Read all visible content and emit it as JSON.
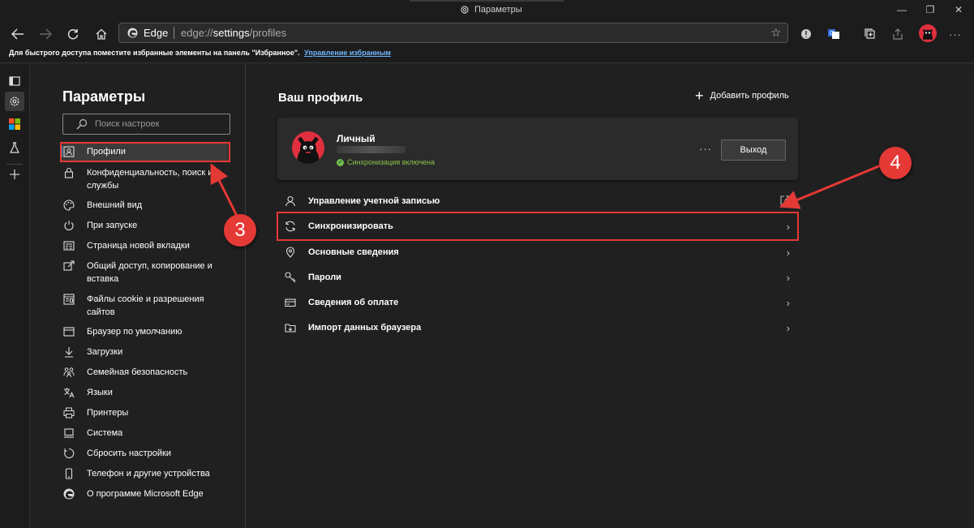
{
  "window": {
    "title": "Параметры"
  },
  "toolbar": {
    "site_name": "Edge",
    "url_prefix": "edge://",
    "url_bold": "settings",
    "url_suffix": "/profiles"
  },
  "favbar": {
    "message": "Для быстрого доступа поместите избранные элементы на панель \"Избранное\".",
    "link": "Управление избранным"
  },
  "nav": {
    "title": "Параметры",
    "search_placeholder": "Поиск настроек",
    "items": [
      {
        "label": "Профили",
        "icon": "profile-icon",
        "active": true
      },
      {
        "label": "Конфиденциальность, поиск и службы",
        "icon": "lock-icon"
      },
      {
        "label": "Внешний вид",
        "icon": "palette-icon"
      },
      {
        "label": "При запуске",
        "icon": "power-icon"
      },
      {
        "label": "Страница новой вкладки",
        "icon": "new-tab-icon"
      },
      {
        "label": "Общий доступ, копирование и вставка",
        "icon": "share-icon"
      },
      {
        "label": "Файлы cookie и разрешения сайтов",
        "icon": "cookie-icon"
      },
      {
        "label": "Браузер по умолчанию",
        "icon": "browser-icon"
      },
      {
        "label": "Загрузки",
        "icon": "download-icon"
      },
      {
        "label": "Семейная безопасность",
        "icon": "family-icon"
      },
      {
        "label": "Языки",
        "icon": "language-icon"
      },
      {
        "label": "Принтеры",
        "icon": "printer-icon"
      },
      {
        "label": "Система",
        "icon": "system-icon"
      },
      {
        "label": "Сбросить настройки",
        "icon": "reset-icon"
      },
      {
        "label": "Телефон и другие устройства",
        "icon": "phone-icon"
      },
      {
        "label": "О программе Microsoft Edge",
        "icon": "edge-icon"
      }
    ]
  },
  "main": {
    "title": "Ваш профиль",
    "add_profile": "Добавить профиль",
    "profile": {
      "name": "Личный",
      "sync_status": "Синхронизация включена",
      "more": "···",
      "logout": "Выход"
    },
    "rows": [
      {
        "label": "Управление учетной записью",
        "icon": "person-icon",
        "trailing": "external-link-icon"
      },
      {
        "label": "Синхронизировать",
        "icon": "sync-icon",
        "trailing": "chevron-right-icon"
      },
      {
        "label": "Основные сведения",
        "icon": "location-pin-icon",
        "trailing": "chevron-right-icon"
      },
      {
        "label": "Пароли",
        "icon": "key-icon",
        "trailing": "chevron-right-icon"
      },
      {
        "label": "Сведения об оплате",
        "icon": "card-icon",
        "trailing": "chevron-right-icon"
      },
      {
        "label": "Импорт данных браузера",
        "icon": "import-icon",
        "trailing": "chevron-right-icon"
      }
    ]
  },
  "annotations": {
    "badge_left": "3",
    "badge_right": "4",
    "color": "#e53935"
  },
  "colors": {
    "background": "#202020",
    "card": "#2b2b2b",
    "accent": "#4a90d9",
    "sync_ok": "#8bc34a",
    "link": "#6fb6ff"
  }
}
